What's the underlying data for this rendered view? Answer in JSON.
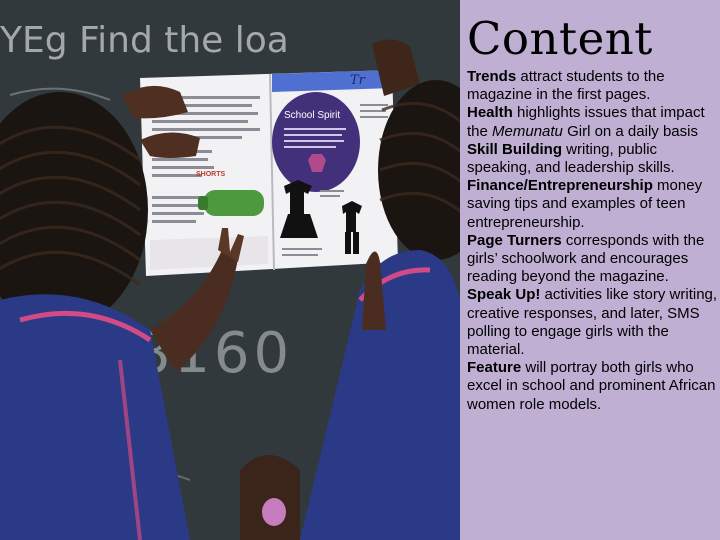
{
  "slide": {
    "title": "Content",
    "photo": {
      "chalk_text_top": "YEg  Find the  loa",
      "chalk_text_mid": "78160",
      "magazine_heading": "School Spirit",
      "magazine_tab": "Tr",
      "magazine_label": "SHORTS",
      "magazine_question": "Do you know your school? Show school spirit by wearing school apparel with your favorite accessories."
    },
    "items": [
      {
        "term": "Trends",
        "desc": " attract students to the magazine in the first pages."
      },
      {
        "term": "Health",
        "desc_before": " highlights issues that impact the ",
        "emphasis": "Memunatu",
        "desc_after": " Girl on a daily basis"
      },
      {
        "term": "Skill Building",
        "desc": " writing, public speaking, and leadership skills."
      },
      {
        "term": "Finance/Entrepreneurship",
        "desc": " money saving tips and examples of teen entrepreneurship."
      },
      {
        "term": "Page Turners",
        "desc": " corresponds with the girls’ schoolwork and encourages reading beyond the magazine."
      },
      {
        "term": "Speak Up!",
        "desc": " activities like story writing, creative responses, and later, SMS polling to engage girls with the material."
      },
      {
        "term": "Feature",
        "desc": " will portray both girls who excel in school and prominent African women role models."
      }
    ]
  }
}
